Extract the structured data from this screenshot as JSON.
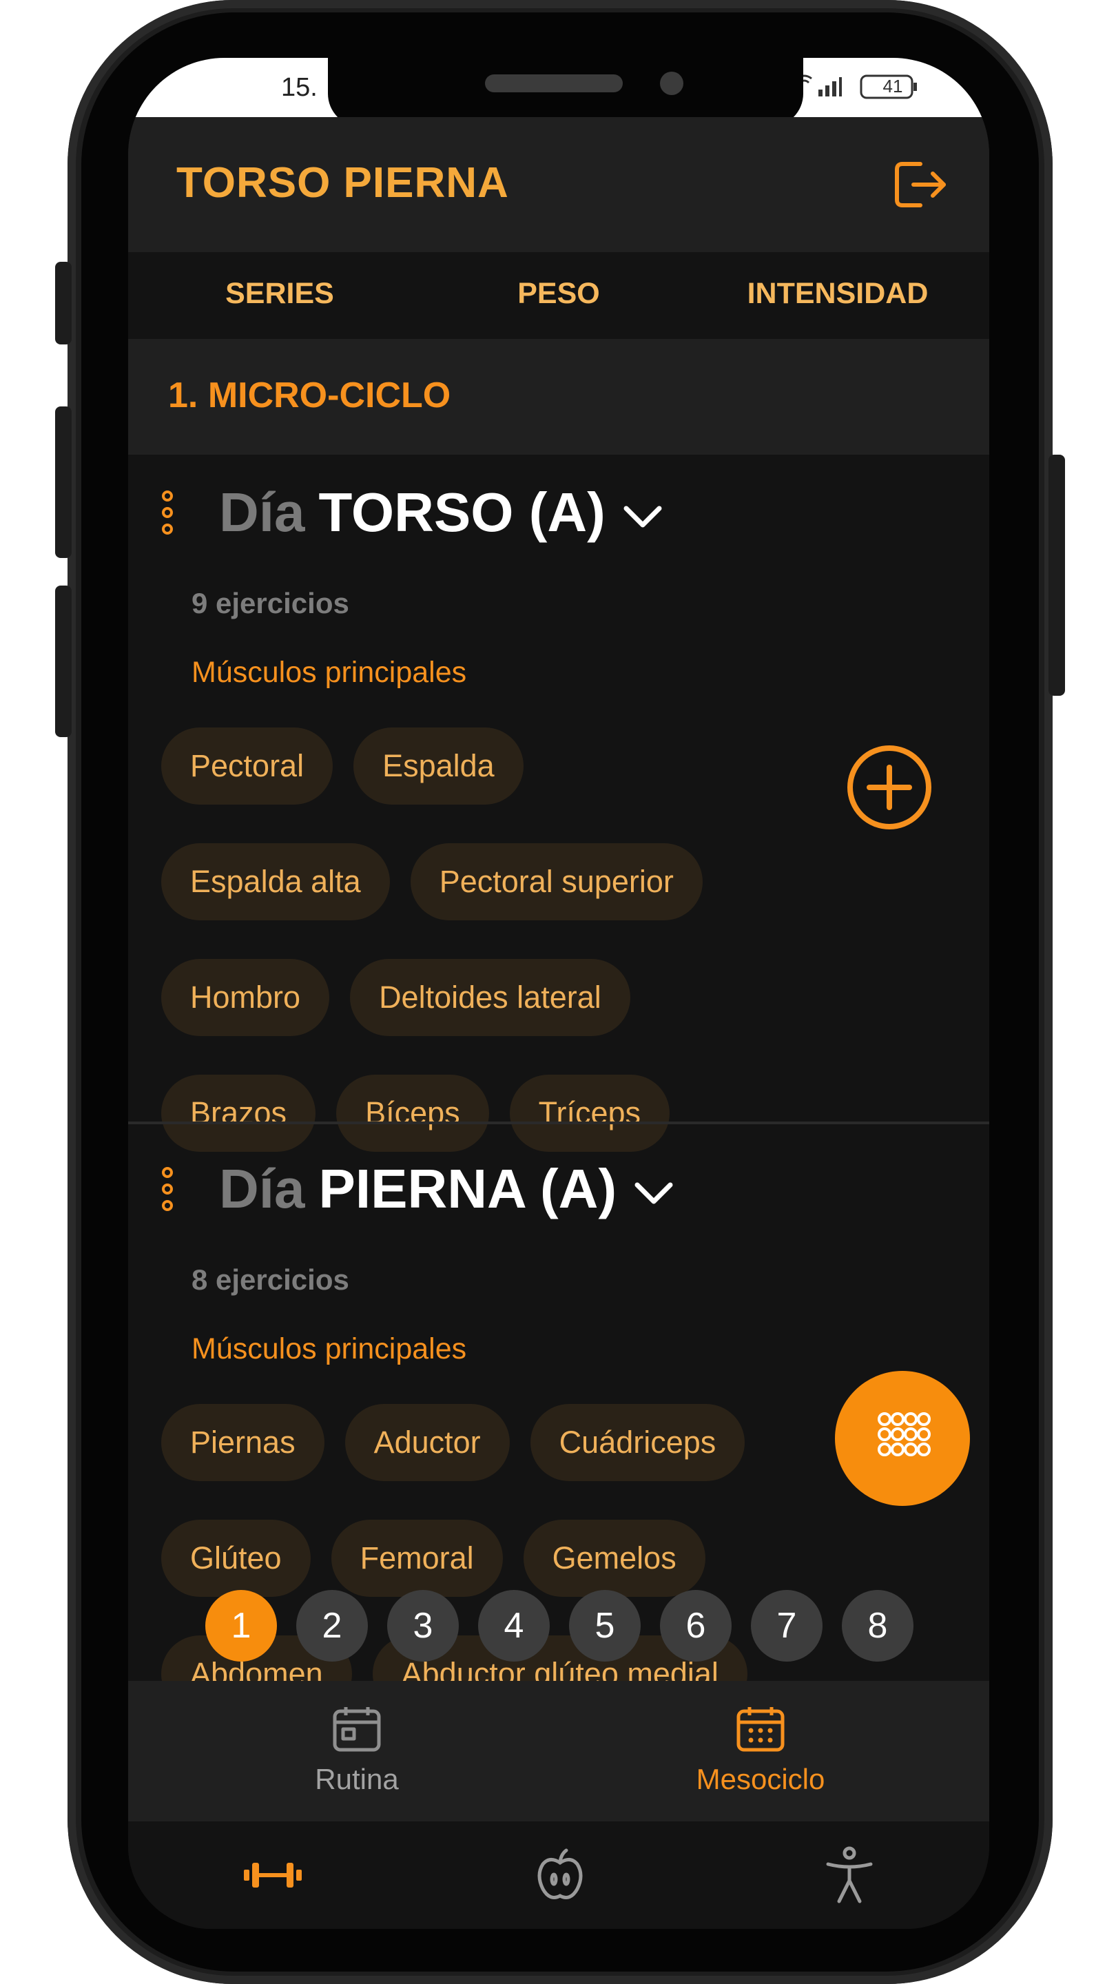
{
  "status_bar": {
    "time": "15.",
    "battery": "41"
  },
  "header": {
    "title": "TORSO PIERNA",
    "logout_icon": "logout-icon"
  },
  "tabs": [
    {
      "label": "SERIES"
    },
    {
      "label": "PESO"
    },
    {
      "label": "INTENSIDAD"
    }
  ],
  "microcycle": {
    "title": "1. MICRO-CICLO"
  },
  "days": [
    {
      "prefix": "Día",
      "name": "TORSO (A)",
      "exercises": "9 ejercicios",
      "muscles_label": "Músculos principales",
      "muscles": [
        "Pectoral",
        "Espalda",
        "Espalda alta",
        "Pectoral superior",
        "Hombro",
        "Deltoides lateral",
        "Brazos",
        "Bíceps",
        "Tríceps"
      ]
    },
    {
      "prefix": "Día",
      "name": "PIERNA (A)",
      "exercises": "8 ejercicios",
      "muscles_label": "Músculos principales",
      "muscles": [
        "Piernas",
        "Aductor",
        "Cuádriceps",
        "Glúteo",
        "Femoral",
        "Gemelos",
        "Abdomen",
        "Abductor glúteo medial"
      ]
    }
  ],
  "pagination": {
    "pages": [
      "1",
      "2",
      "3",
      "4",
      "5",
      "6",
      "7",
      "8"
    ],
    "active": "1"
  },
  "subnav": [
    {
      "label": "Rutina",
      "icon": "calendar-icon",
      "active": false
    },
    {
      "label": "Mesociclo",
      "icon": "calendar-grid-icon",
      "active": true
    }
  ],
  "mainnav": [
    {
      "icon": "dumbbell-icon",
      "active": true
    },
    {
      "icon": "apple-icon",
      "active": false
    },
    {
      "icon": "accessibility-icon",
      "active": false
    }
  ],
  "colors": {
    "accent": "#f7911e",
    "accent_light": "#f6b85d",
    "background": "#131313",
    "surface": "#202020",
    "chip_bg": "#2a2217",
    "chip_text": "#f0b15a",
    "muted": "#7a7a7a"
  }
}
